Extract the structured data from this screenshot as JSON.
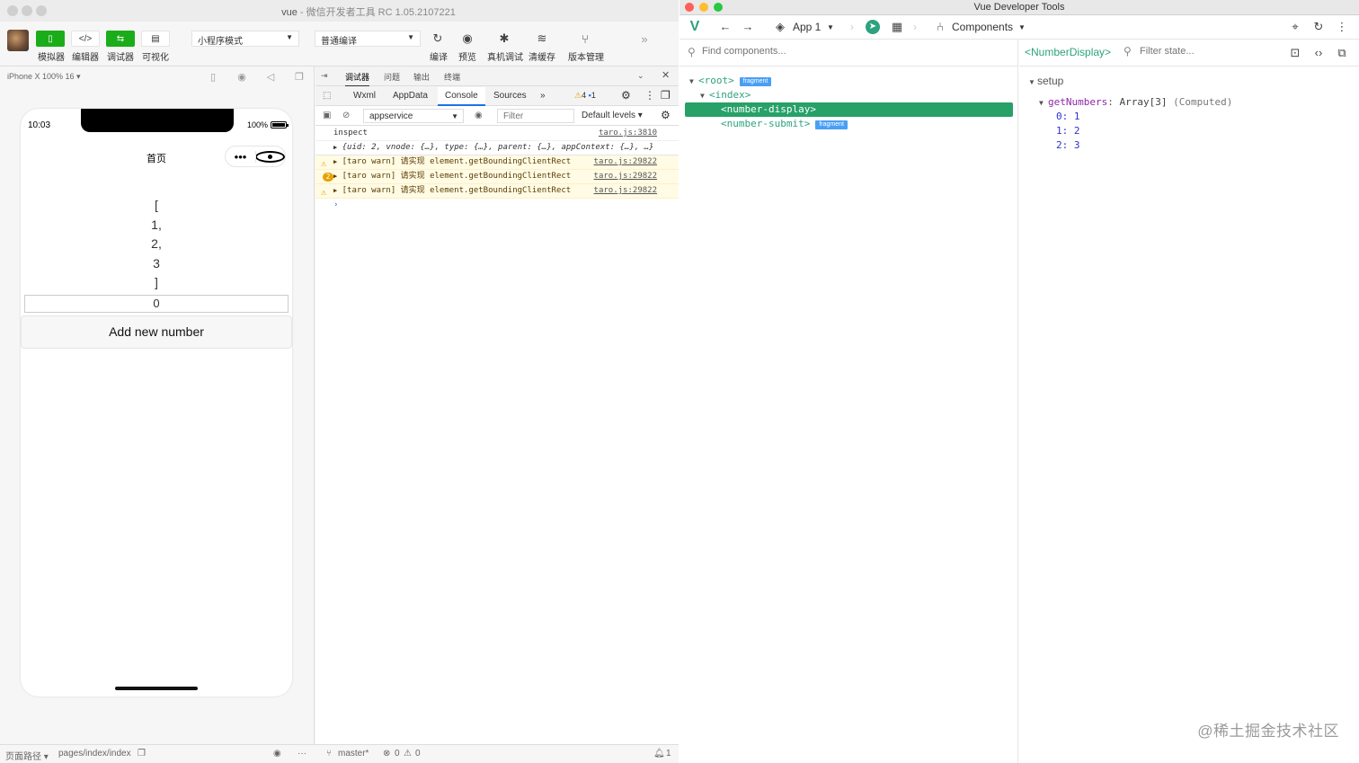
{
  "wechat": {
    "title": "vue",
    "subtitle": "- 微信开发者工具 RC 1.05.2107221",
    "toolbar": {
      "simulator": "模拟器",
      "editor": "编辑器",
      "debugger": "调试器",
      "visual": "可视化",
      "mode_select": "小程序模式",
      "compile_select": "普通编译",
      "compile": "编译",
      "preview": "预览",
      "remote_debug": "真机调试",
      "clear_cache": "清缓存",
      "version_mgmt": "版本管理"
    },
    "device_label": "iPhone X 100% 16 ▾",
    "phone": {
      "time": "10:03",
      "battery": "100%",
      "nav_title": "首页",
      "numbers": [
        "[",
        "1,",
        "2,",
        "3",
        "]"
      ],
      "input_value": "0",
      "button_label": "Add new number"
    },
    "debugger": {
      "top_tabs": [
        "调试器",
        "问题",
        "输出",
        "终端"
      ],
      "tabs": [
        "Wxml",
        "AppData",
        "Console",
        "Sources"
      ],
      "active_tab": "Console",
      "warn_count": "4",
      "info_count": "1",
      "context": "appservice",
      "filter_placeholder": "Filter",
      "levels": "Default levels ▾",
      "console": [
        {
          "text": "inspect",
          "src": "taro.js:3810",
          "level": "log"
        },
        {
          "text": "{uid: 2, vnode: {…}, type: {…}, parent: {…}, appContext: {…}, …}",
          "src": "",
          "level": "object"
        },
        {
          "text": "[taro warn] 请实现 element.getBoundingClientRect",
          "src": "taro.js:29822",
          "level": "warn"
        },
        {
          "text": "[taro warn] 请实现 element.getBoundingClientRect",
          "src": "taro.js:29822",
          "level": "warn",
          "count": "2"
        },
        {
          "text": "[taro warn] 请实现 element.getBoundingClientRect",
          "src": "taro.js:29822",
          "level": "warn"
        }
      ]
    },
    "status": {
      "page_path_label": "页面路径 ▾",
      "page_path": "pages/index/index",
      "branch": "master*",
      "errors": "0",
      "warnings": "0",
      "notifications": "1"
    }
  },
  "vue_devtools": {
    "title": "Vue Developer Tools",
    "app": "App 1",
    "section": "Components",
    "search_placeholder": "Find components...",
    "tree": [
      {
        "label": "<root>",
        "badge": "fragment"
      },
      {
        "label": "<index>",
        "badge": ""
      },
      {
        "label": "<number-display>",
        "badge": "",
        "selected": true
      },
      {
        "label": "<number-submit>",
        "badge": "fragment"
      }
    ],
    "selected_component": "<NumberDisplay>",
    "state_filter_placeholder": "Filter state...",
    "state": {
      "section": "setup",
      "key": "getNumbers",
      "summary": "Array[3]",
      "note": "(Computed)",
      "items": [
        {
          "index": "0",
          "value": "1"
        },
        {
          "index": "1",
          "value": "2"
        },
        {
          "index": "2",
          "value": "3"
        }
      ]
    },
    "watermark": "@稀土掘金技术社区"
  },
  "colors": {
    "wechat_green": "#1aad19",
    "vue_green": "#2ca37e",
    "selection_green": "#27a168",
    "badge_blue": "#4a9ff5",
    "warning_bg": "#fffbe5"
  }
}
